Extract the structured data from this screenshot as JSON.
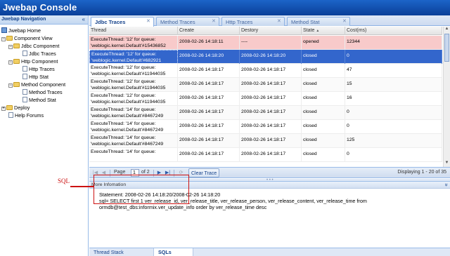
{
  "app": {
    "title": "Jwebap Console"
  },
  "nav": {
    "title": "Jwebap Navigation",
    "collapse_icon": "«",
    "items": [
      {
        "label": "Jwebap Home"
      },
      {
        "label": "Component View"
      },
      {
        "label": "Jdbc Component"
      },
      {
        "label": "Jdbc Traces"
      },
      {
        "label": "Http Component"
      },
      {
        "label": "Http Traces"
      },
      {
        "label": "Http Stat"
      },
      {
        "label": "Method Component"
      },
      {
        "label": "Method Traces"
      },
      {
        "label": "Method Stat"
      },
      {
        "label": "Deploy"
      },
      {
        "label": "Help Forums"
      }
    ]
  },
  "tabs": [
    {
      "label": "Jdbc Traces"
    },
    {
      "label": "Method Traces"
    },
    {
      "label": "Http Traces"
    },
    {
      "label": "Method Stat"
    }
  ],
  "grid": {
    "columns": [
      "Thread",
      "Create",
      "Destory",
      "State",
      "Cost(ms)"
    ],
    "sort_indicator": "▲",
    "rows": [
      {
        "thread1": "ExecuteThread: '12' for queue:",
        "thread2": "'weblogic.kernel.Default'#15436852",
        "create": "2008-02-26 14:18:11",
        "destroy": "----",
        "state": "opened",
        "cost": "12344",
        "style": "error"
      },
      {
        "thread1": "ExecuteThread: '12' for queue:",
        "thread2": "'weblogic.kernel.Default'#682921",
        "create": "2008-02-26 14:18:20",
        "destroy": "2008-02-26 14:18:20",
        "state": "closed",
        "cost": "0",
        "style": "selected"
      },
      {
        "thread1": "ExecuteThread: '12' for queue:",
        "thread2": "'weblogic.kernel.Default'#11944035",
        "create": "2008-02-26 14:18:17",
        "destroy": "2008-02-26 14:18:17",
        "state": "closed",
        "cost": "47",
        "style": ""
      },
      {
        "thread1": "ExecuteThread: '12' for queue:",
        "thread2": "'weblogic.kernel.Default'#11944035",
        "create": "2008-02-26 14:18:17",
        "destroy": "2008-02-26 14:18:17",
        "state": "closed",
        "cost": "15",
        "style": "alt"
      },
      {
        "thread1": "ExecuteThread: '12' for queue:",
        "thread2": "'weblogic.kernel.Default'#11944035",
        "create": "2008-02-26 14:18:17",
        "destroy": "2008-02-26 14:18:17",
        "state": "closed",
        "cost": "16",
        "style": ""
      },
      {
        "thread1": "ExecuteThread: '14' for queue:",
        "thread2": "'weblogic.kernel.Default'#8467249",
        "create": "2008-02-26 14:18:17",
        "destroy": "2008-02-26 14:18:17",
        "state": "closed",
        "cost": "0",
        "style": "alt"
      },
      {
        "thread1": "ExecuteThread: '14' for queue:",
        "thread2": "'weblogic.kernel.Default'#8467249",
        "create": "2008-02-26 14:18:17",
        "destroy": "2008-02-26 14:18:17",
        "state": "closed",
        "cost": "0",
        "style": ""
      },
      {
        "thread1": "ExecuteThread: '14' for queue:",
        "thread2": "'weblogic.kernel.Default'#8467249",
        "create": "2008-02-26 14:18:17",
        "destroy": "2008-02-26 14:18:17",
        "state": "closed",
        "cost": "125",
        "style": "alt"
      },
      {
        "thread1": "ExecuteThread: '14' for queue:",
        "thread2": "",
        "create": "2008-02-26 14:18:17",
        "destroy": "2008-02-26 14:18:17",
        "state": "closed",
        "cost": "0",
        "style": ""
      }
    ]
  },
  "pager": {
    "page_label": "Page",
    "current_page": "1",
    "of_label": "of 2",
    "clear_label": "Clear Trace",
    "displaying": "Displaying 1 - 20 of 35"
  },
  "info": {
    "title": "More Infomation",
    "collapse_icon": "»",
    "statement": "Statement: 2008-02-26 14:18:20/2008-02-26 14:18:20",
    "sql1": "sql= SELECT first 1 ver_release_id, ver_release_title, ver_release_person, ver_release_content, ver_release_time from",
    "sql2": "ormdb@test_dbs:informix.ver_update_info order by ver_release_time desc",
    "tabs": [
      {
        "label": "Thread Stack"
      },
      {
        "label": "SQLs"
      }
    ]
  },
  "annotation": {
    "label": "SQL",
    "color": "#cc1111"
  },
  "colors": {
    "title_bar": "#0a3f98",
    "selected_row": "#3366cc",
    "error_row": "#f8caca"
  }
}
